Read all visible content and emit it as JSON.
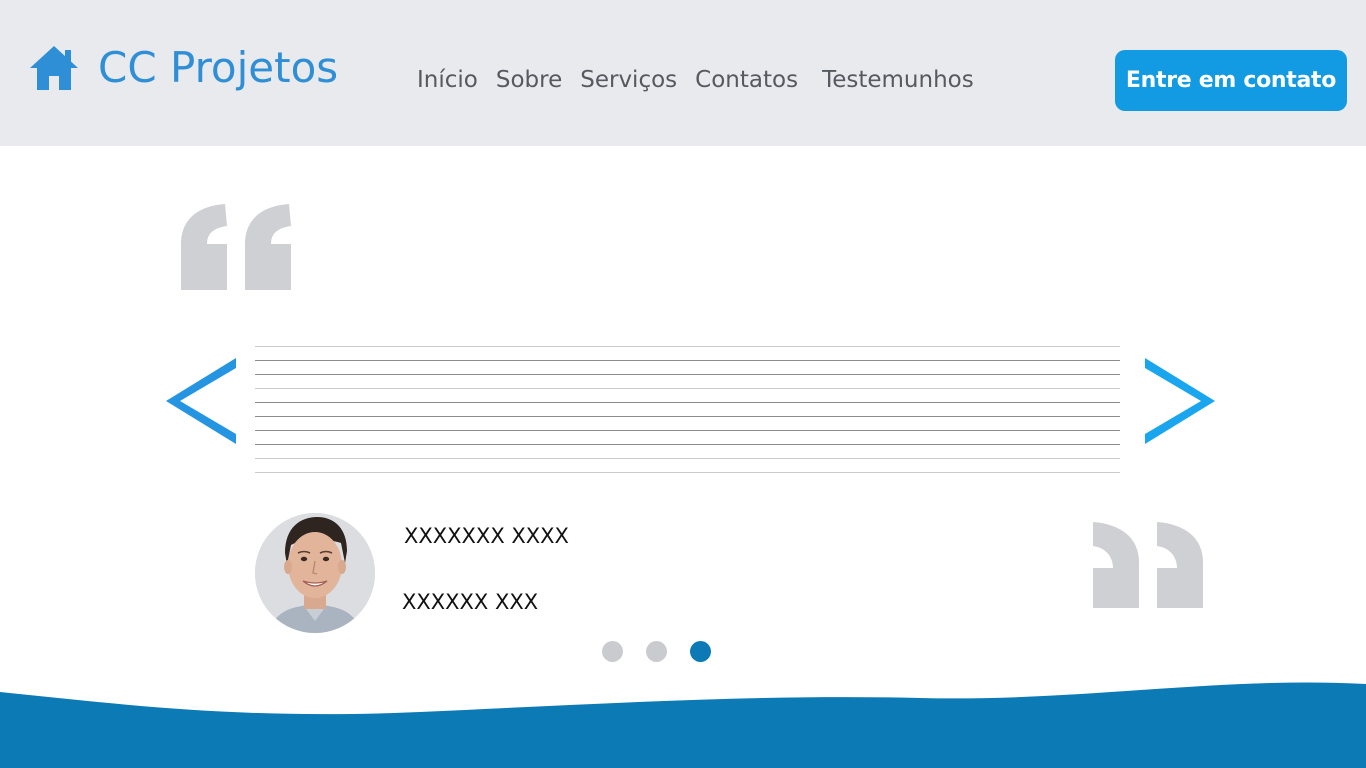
{
  "brand": {
    "name": "CC Projetos",
    "color": "#2f8fd6",
    "icon": "home-icon"
  },
  "nav": {
    "items": [
      {
        "label": "Início"
      },
      {
        "label": "Sobre"
      },
      {
        "label": "Serviços"
      },
      {
        "label": "Contatos"
      },
      {
        "label": "Testemunhos"
      }
    ]
  },
  "cta": {
    "label": "Entre em contato",
    "color": "#129be3"
  },
  "testimonial": {
    "open_quote_icon": "open-quote-icon",
    "close_quote_icon": "close-quote-icon",
    "prev_icon": "chevron-left-icon",
    "next_icon": "chevron-right-icon",
    "person": {
      "name": "XXXXXXX XXXX",
      "role": "XXXXXX XXX",
      "avatar": "avatar-photo"
    }
  },
  "carousel": {
    "total": 3,
    "active_index": 2
  },
  "colors": {
    "header_bg": "#e9eaee",
    "accent_dark": "#0c7ab5",
    "quote_gray": "#cfd0d3",
    "arrow_blue": "#1aa5ef"
  }
}
